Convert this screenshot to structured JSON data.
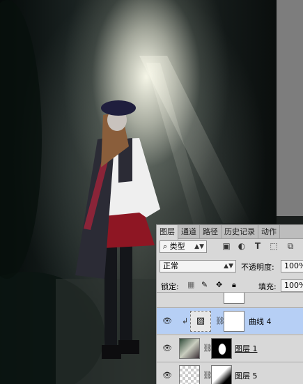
{
  "panel": {
    "tabs": [
      "图层",
      "通道",
      "路径",
      "历史记录",
      "动作"
    ],
    "filter": {
      "icon": "search-icon",
      "value": "类型"
    },
    "blend_mode": "正常",
    "opacity_label": "不透明度:",
    "opacity_value": "100%",
    "lock_label": "锁定:",
    "fill_label": "填充:",
    "fill_value": "100%",
    "layers": [
      {
        "name": "曲线 4",
        "selected": true
      },
      {
        "name": "图层 1",
        "selected": false
      },
      {
        "name": "图层 5",
        "selected": false
      }
    ]
  }
}
